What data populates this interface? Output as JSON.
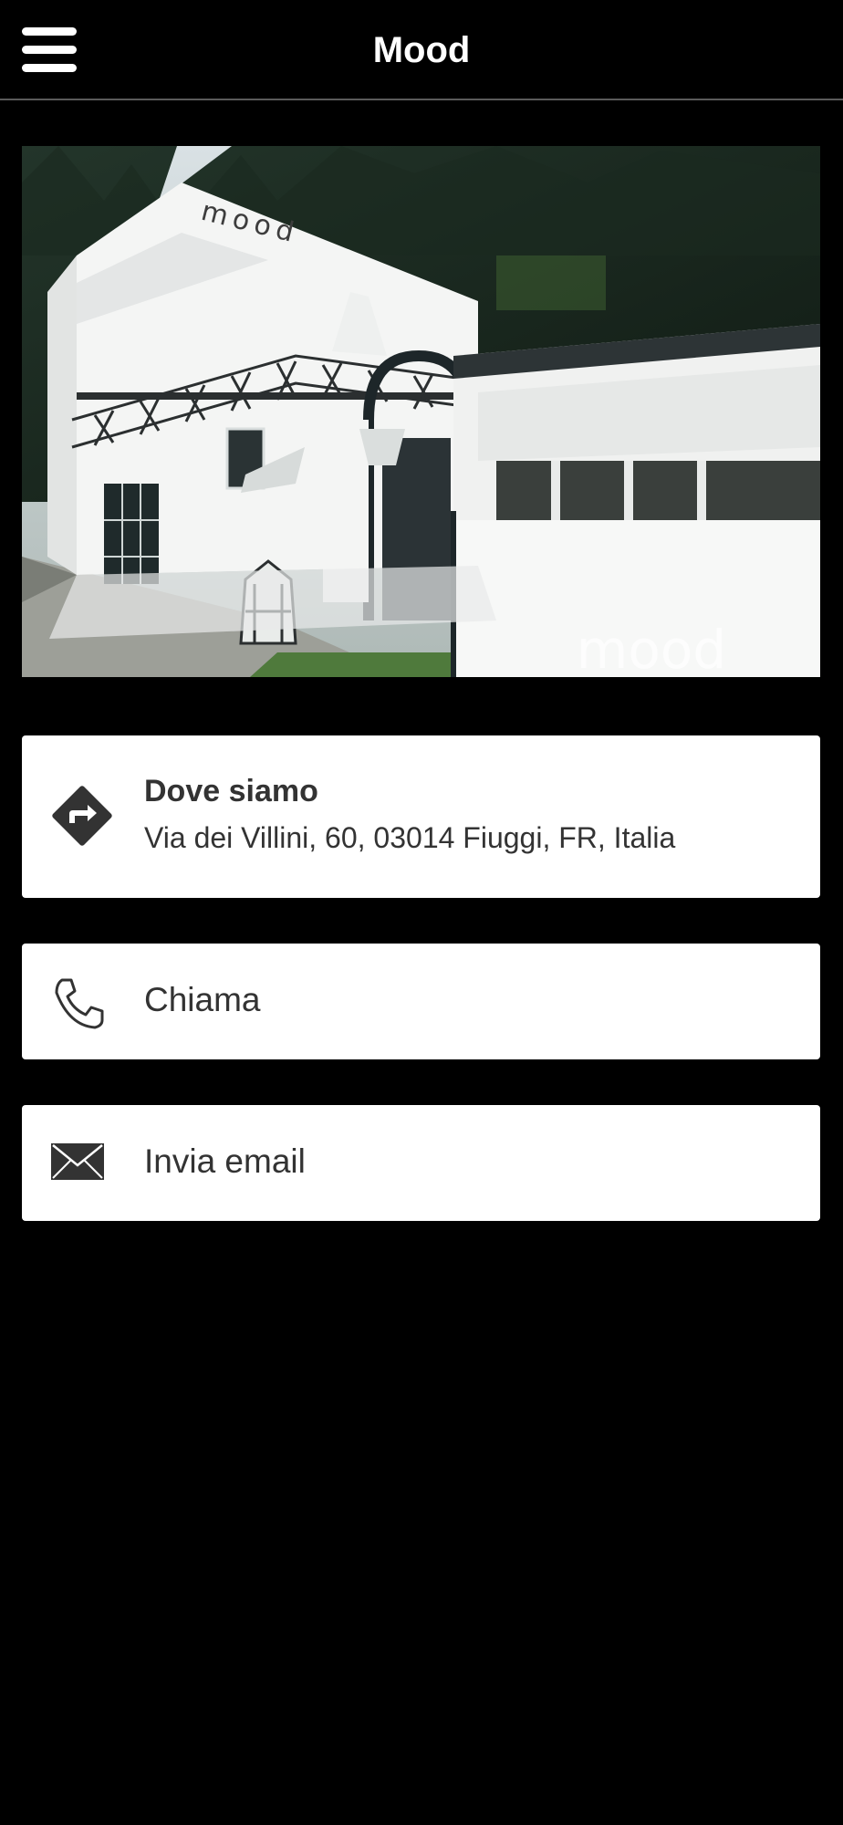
{
  "header": {
    "title": "Mood",
    "menu_icon": "hamburger-menu-icon"
  },
  "hero": {
    "image_desc": "photo-of-mood-building",
    "sign_text": "mood",
    "watermark": "mood"
  },
  "location": {
    "title": "Dove siamo",
    "address": "Via dei Villini, 60, 03014 Fiuggi, FR, Italia",
    "icon": "directions-icon"
  },
  "call": {
    "label": "Chiama",
    "icon": "phone-icon"
  },
  "email": {
    "label": "Invia email",
    "icon": "envelope-icon"
  },
  "colors": {
    "background": "#000000",
    "card": "#ffffff",
    "text": "#333333",
    "header_divider": "#5a5a5a"
  }
}
